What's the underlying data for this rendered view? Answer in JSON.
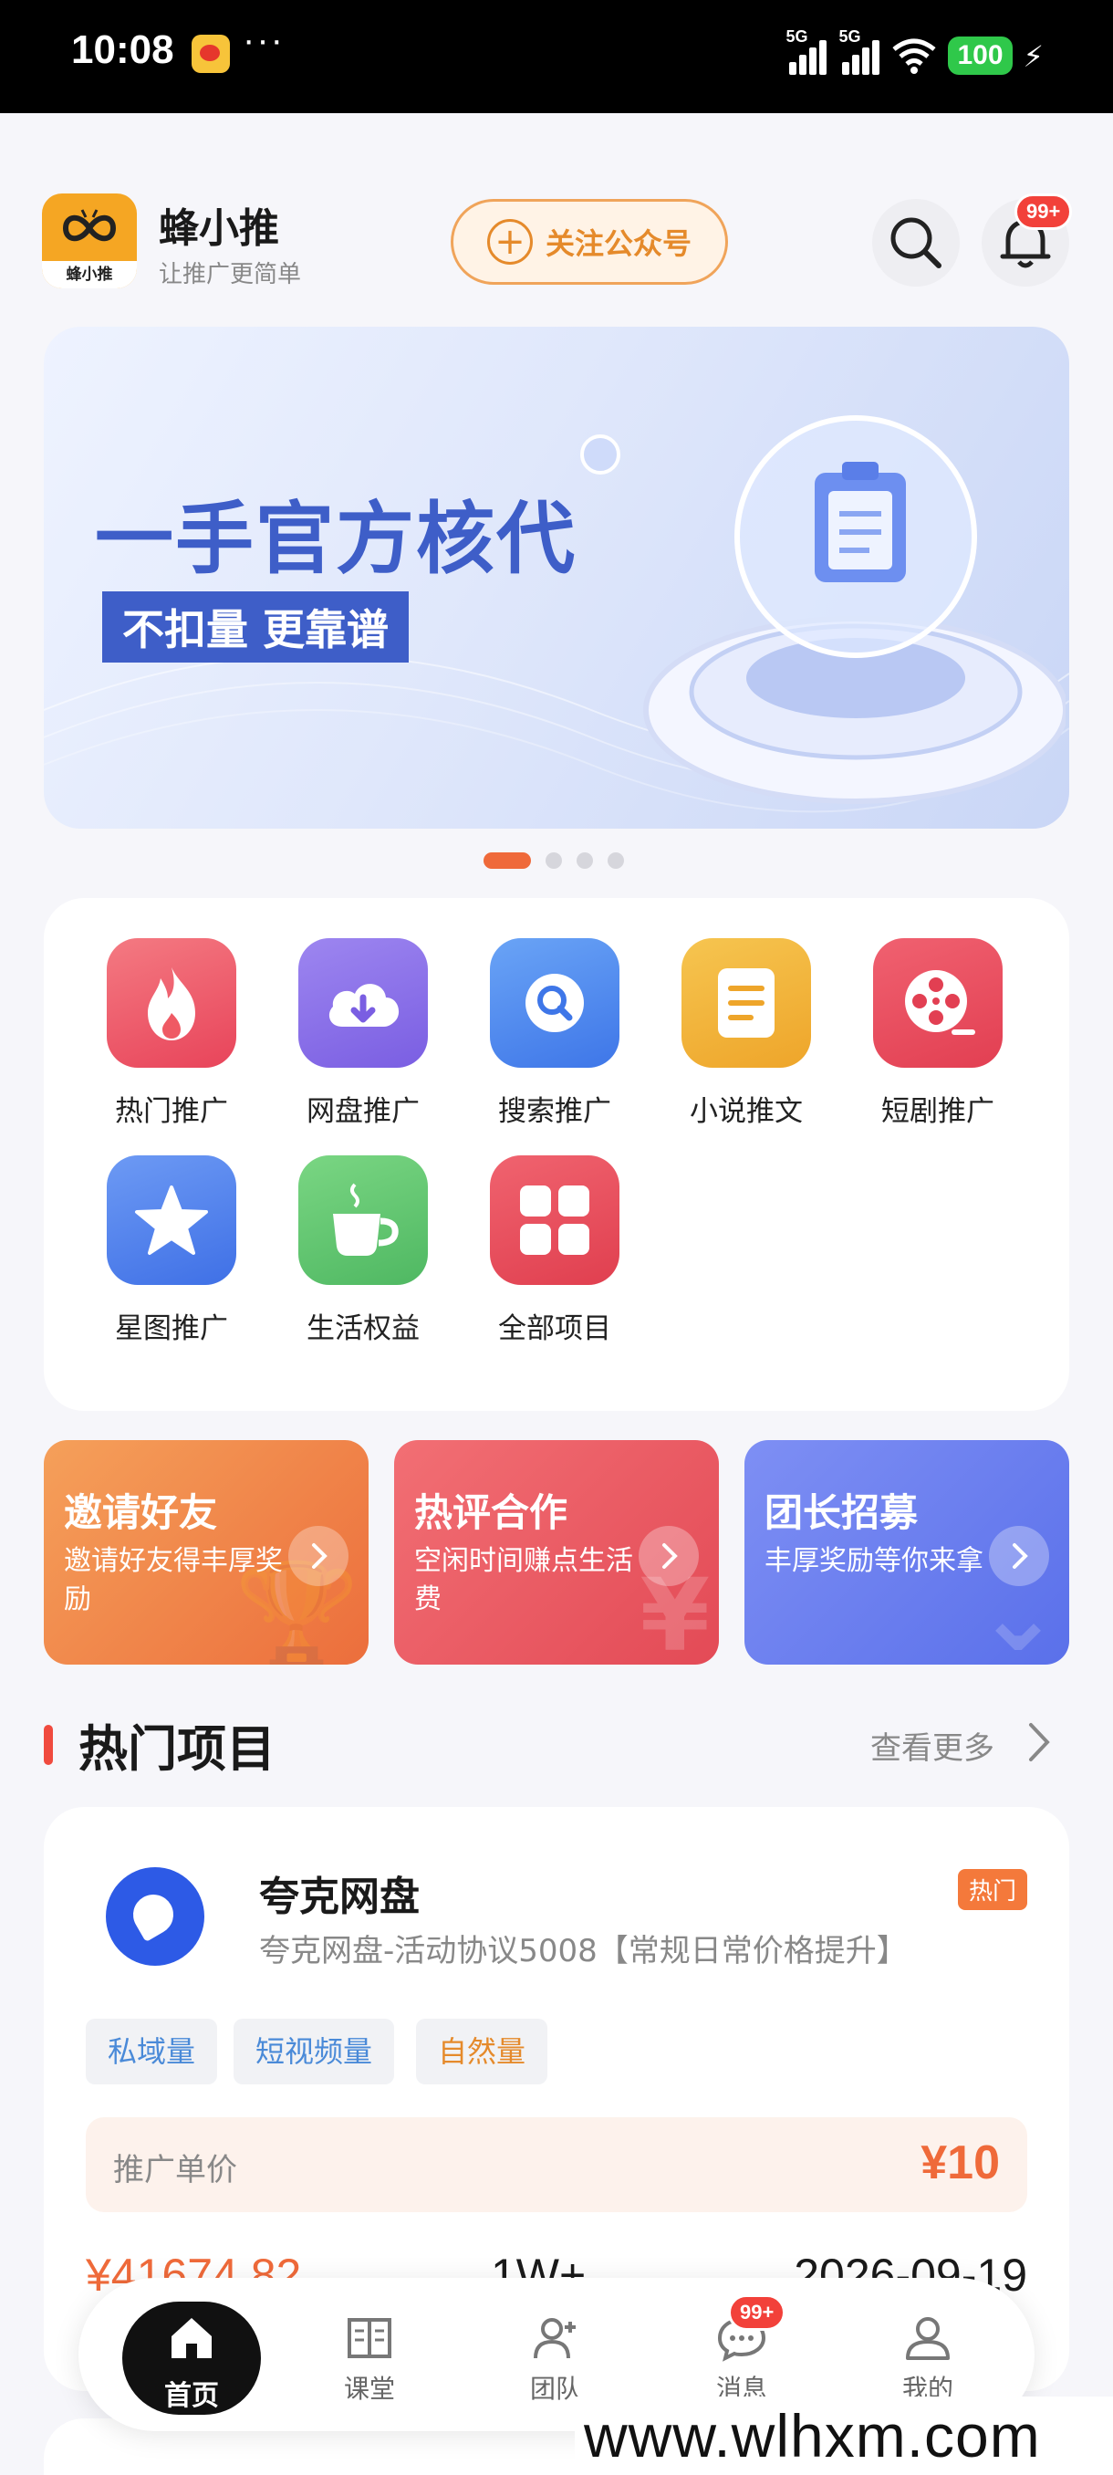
{
  "status_bar": {
    "time": "10:08",
    "dots": "···",
    "signal1_label": "5G",
    "signal2_label": "5G",
    "wifi_sub": "6",
    "battery": "100"
  },
  "header": {
    "app_name": "蜂小推",
    "slogan": "让推广更简单",
    "logo_text": "蜂小推",
    "follow_label": "关注公众号",
    "notif_badge": "99+"
  },
  "banner": {
    "title": "一手官方核代",
    "subtitle": "不扣量 更靠谱",
    "slide_count": 4,
    "active_slide": 0
  },
  "categories": [
    {
      "label": "热门推广",
      "icon": "fire-icon",
      "color": "#ef5a64"
    },
    {
      "label": "网盘推广",
      "icon": "cloud-download-icon",
      "color": "#8a6ee8"
    },
    {
      "label": "搜索推广",
      "icon": "search-icon",
      "color": "#4d8af0"
    },
    {
      "label": "小说推文",
      "icon": "document-icon",
      "color": "#f2b23c"
    },
    {
      "label": "短剧推广",
      "icon": "film-reel-icon",
      "color": "#ec4d5e"
    },
    {
      "label": "星图推广",
      "icon": "star-icon",
      "color": "#4f82ee"
    },
    {
      "label": "生活权益",
      "icon": "coffee-cup-icon",
      "color": "#62c772"
    },
    {
      "label": "全部项目",
      "icon": "grid-icon",
      "color": "#e9505e"
    }
  ],
  "promos": [
    {
      "title": "邀请好友",
      "desc": "邀请好友得丰厚奖励"
    },
    {
      "title": "热评合作",
      "desc": "空闲时间赚点生活费"
    },
    {
      "title": "团长招募",
      "desc": "丰厚奖励等你来拿"
    }
  ],
  "section": {
    "title": "热门项目",
    "more_label": "查看更多"
  },
  "project": {
    "name": "夸克网盘",
    "desc": "夸克网盘-活动协议5008【常规日常价格提升】",
    "hot_label": "热门",
    "tags": [
      {
        "label": "私域量",
        "color": "#4a8ad8"
      },
      {
        "label": "短视频量",
        "color": "#4a8ad8"
      },
      {
        "label": "自然量",
        "color": "#e58a2b"
      }
    ],
    "price_label": "推广单价",
    "price_value": "¥10",
    "stat_amount": "¥41674.82",
    "stat_count": "1W+",
    "stat_date": "2026-09-19"
  },
  "nav": {
    "items": [
      {
        "label": "首页",
        "icon": "home-icon"
      },
      {
        "label": "课堂",
        "icon": "book-icon"
      },
      {
        "label": "团队",
        "icon": "team-icon"
      },
      {
        "label": "消息",
        "icon": "message-icon"
      },
      {
        "label": "我的",
        "icon": "user-icon"
      }
    ],
    "msg_badge": "99+"
  },
  "watermark": "www.wlhxm.com",
  "colors": {
    "accent": "#ef6a3a",
    "banner_blue": "#3e5ec8",
    "promo1": "#f08a45",
    "promo2": "#ee5a66",
    "promo3": "#6a7ff0"
  }
}
